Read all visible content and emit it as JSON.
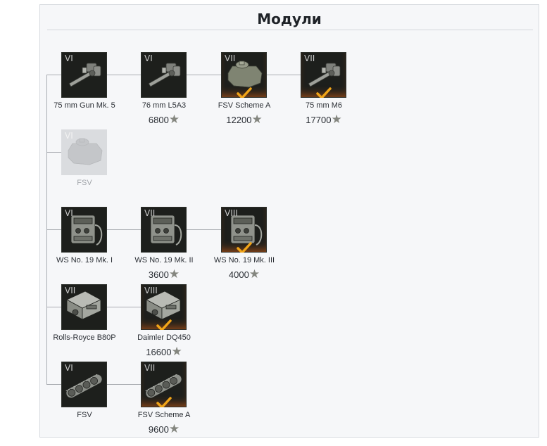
{
  "panel": {
    "title": "Модули"
  },
  "rows": [
    {
      "modules": [
        {
          "tier": "VI",
          "name": "75 mm Gun Mk. 5",
          "price": "",
          "icon": "gun-icon",
          "installed": false,
          "locked": false
        },
        {
          "tier": "VI",
          "name": "76 mm L5A3",
          "price": "6800",
          "icon": "gun-icon",
          "installed": false,
          "locked": false
        },
        {
          "tier": "VII",
          "name": "FSV Scheme A",
          "price": "12200",
          "icon": "turret-icon",
          "installed": true,
          "locked": false
        },
        {
          "tier": "VII",
          "name": "75 mm M6",
          "price": "17700",
          "icon": "gun-icon",
          "installed": true,
          "locked": false
        }
      ]
    },
    {
      "modules": [
        {
          "tier": "VI",
          "name": "FSV",
          "price": "",
          "icon": "turret-icon",
          "installed": false,
          "locked": true
        }
      ]
    },
    {
      "modules": [
        {
          "tier": "VI",
          "name": "WS No. 19 Mk. I",
          "price": "",
          "icon": "radio-icon",
          "installed": false,
          "locked": false
        },
        {
          "tier": "VII",
          "name": "WS No. 19 Mk. II",
          "price": "3600",
          "icon": "radio-icon",
          "installed": false,
          "locked": false
        },
        {
          "tier": "VIII",
          "name": "WS No. 19 Mk. III",
          "price": "4000",
          "icon": "radio-icon",
          "installed": true,
          "locked": false
        }
      ]
    },
    {
      "modules": [
        {
          "tier": "VII",
          "name": "Rolls-Royce B80P",
          "price": "",
          "icon": "engine-icon",
          "installed": false,
          "locked": false
        },
        {
          "tier": "VIII",
          "name": "Daimler DQ450",
          "price": "16600",
          "icon": "engine-icon",
          "installed": true,
          "locked": false
        }
      ]
    },
    {
      "modules": [
        {
          "tier": "VI",
          "name": "FSV",
          "price": "",
          "icon": "tracks-icon",
          "installed": false,
          "locked": false
        },
        {
          "tier": "VII",
          "name": "FSV Scheme A",
          "price": "9600",
          "icon": "tracks-icon",
          "installed": true,
          "locked": false
        }
      ]
    }
  ]
}
